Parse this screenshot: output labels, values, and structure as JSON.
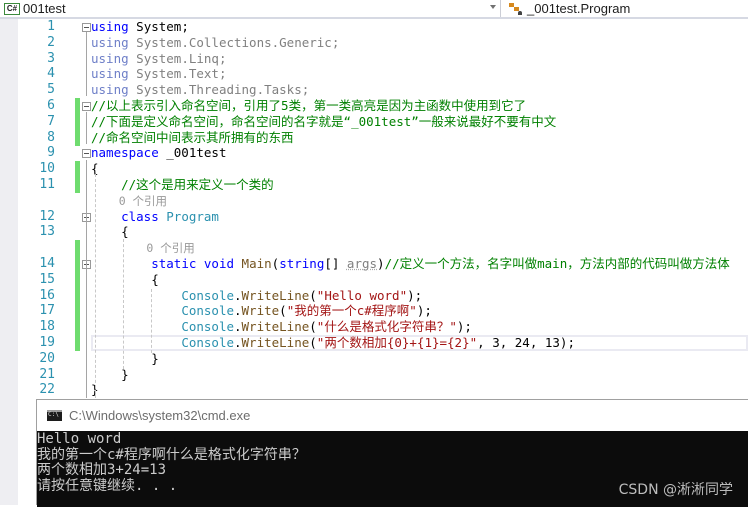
{
  "navbar": {
    "project_icon": "csharp-project-icon",
    "project_name": "001test",
    "class_icon": "class-icon",
    "class_name": "_001test.Program"
  },
  "editor": {
    "lines": [
      {
        "n": "1",
        "tokens": [
          [
            "kw",
            "using"
          ],
          [
            "",
            " System;"
          ]
        ]
      },
      {
        "n": "2",
        "tokens": [
          [
            "kw-dim",
            "using"
          ],
          [
            "dim",
            " System.Collections.Generic;"
          ]
        ]
      },
      {
        "n": "3",
        "tokens": [
          [
            "kw-dim",
            "using"
          ],
          [
            "dim",
            " System.Linq;"
          ]
        ]
      },
      {
        "n": "4",
        "tokens": [
          [
            "kw-dim",
            "using"
          ],
          [
            "dim",
            " System.Text;"
          ]
        ]
      },
      {
        "n": "5",
        "tokens": [
          [
            "kw-dim",
            "using"
          ],
          [
            "dim",
            " System.Threading.Tasks;"
          ]
        ]
      },
      {
        "n": "6",
        "tokens": [
          [
            "cm",
            "//以上表示引入命名空间，引用了5类，第一类高亮是因为主函数中使用到它了"
          ]
        ]
      },
      {
        "n": "7",
        "tokens": [
          [
            "cm",
            "//下面是定义命名空间，命名空间的名字就是“_001test”一般来说最好不要有中文"
          ]
        ]
      },
      {
        "n": "8",
        "tokens": [
          [
            "cm",
            "//命名空间中间表示其所拥有的东西"
          ]
        ]
      },
      {
        "n": "9",
        "tokens": [
          [
            "kw",
            "namespace"
          ],
          [
            "",
            " _001test"
          ]
        ]
      },
      {
        "n": "10",
        "tokens": [
          [
            "",
            "{"
          ]
        ]
      },
      {
        "n": "11",
        "tokens": [
          [
            "",
            "    "
          ],
          [
            "cm",
            "//这个是用来定义一个类的"
          ]
        ]
      },
      {
        "n": "",
        "lens": "    0 个引用"
      },
      {
        "n": "12",
        "tokens": [
          [
            "",
            "    "
          ],
          [
            "kw",
            "class"
          ],
          [
            "",
            " "
          ],
          [
            "ty",
            "Program"
          ]
        ]
      },
      {
        "n": "13",
        "tokens": [
          [
            "",
            "    {"
          ]
        ]
      },
      {
        "n": "",
        "lens": "        0 个引用"
      },
      {
        "n": "14",
        "tokens": [
          [
            "",
            "        "
          ],
          [
            "kw",
            "static"
          ],
          [
            "",
            " "
          ],
          [
            "kw",
            "void"
          ],
          [
            "",
            " "
          ],
          [
            "mt",
            "Main"
          ],
          [
            "",
            "("
          ],
          [
            "kw",
            "string"
          ],
          [
            "",
            "[] "
          ],
          [
            "par",
            "args"
          ],
          [
            "",
            ")"
          ],
          [
            "cm",
            "//定义一个方法，名字叫做main，方法内部的代码叫做方法体"
          ]
        ]
      },
      {
        "n": "15",
        "tokens": [
          [
            "",
            "        {"
          ]
        ]
      },
      {
        "n": "16",
        "tokens": [
          [
            "",
            "            "
          ],
          [
            "ty",
            "Console"
          ],
          [
            "",
            "."
          ],
          [
            "mt",
            "WriteLine"
          ],
          [
            "",
            "("
          ],
          [
            "st",
            "\"Hello word\""
          ],
          [
            "",
            ");"
          ]
        ]
      },
      {
        "n": "17",
        "tokens": [
          [
            "",
            "            "
          ],
          [
            "ty",
            "Console"
          ],
          [
            "",
            "."
          ],
          [
            "mt",
            "Write"
          ],
          [
            "",
            "("
          ],
          [
            "st",
            "\"我的第一个c#程序啊\""
          ],
          [
            "",
            ");"
          ]
        ]
      },
      {
        "n": "18",
        "tokens": [
          [
            "",
            "            "
          ],
          [
            "ty",
            "Console"
          ],
          [
            "",
            "."
          ],
          [
            "mt",
            "WriteLine"
          ],
          [
            "",
            "("
          ],
          [
            "st",
            "\"什么是格式化字符串？\""
          ],
          [
            "",
            ");"
          ]
        ]
      },
      {
        "n": "19",
        "tokens": [
          [
            "",
            "            "
          ],
          [
            "ty",
            "Console"
          ],
          [
            "",
            "."
          ],
          [
            "mt",
            "WriteLine"
          ],
          [
            "",
            "("
          ],
          [
            "st",
            "\"两个数相加{0}+{1}={2}\""
          ],
          [
            "",
            ", 3, 24, 13);"
          ]
        ]
      },
      {
        "n": "20",
        "tokens": [
          [
            "",
            "        }"
          ]
        ]
      },
      {
        "n": "21",
        "tokens": [
          [
            "",
            "    }"
          ]
        ]
      },
      {
        "n": "22",
        "tokens": [
          [
            "",
            "}"
          ]
        ]
      }
    ]
  },
  "console": {
    "title": "C:\\Windows\\system32\\cmd.exe",
    "output": [
      "Hello word",
      "我的第一个c#程序啊什么是格式化字符串？",
      "两个数相加3+24=13",
      "请按任意键继续. . ."
    ]
  },
  "watermark": "CSDN @淅淅同学"
}
